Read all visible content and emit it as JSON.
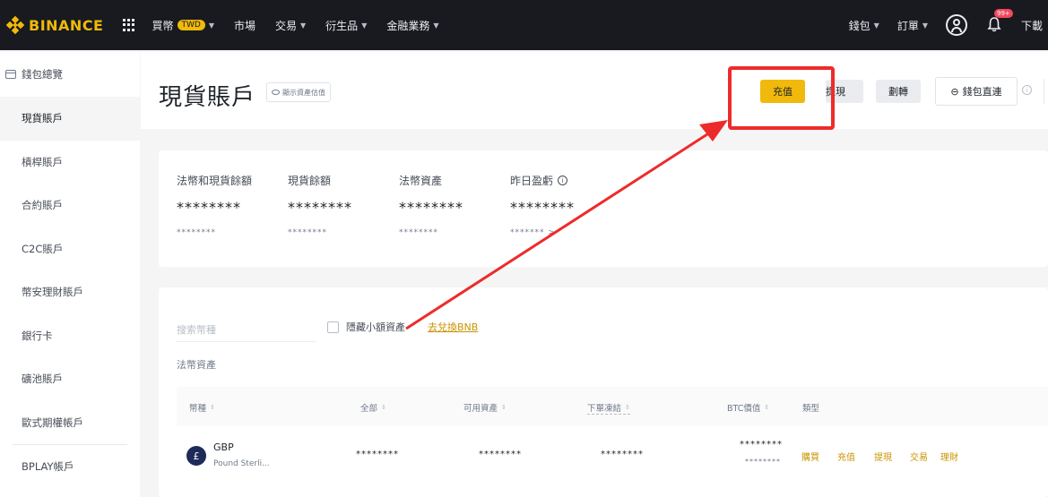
{
  "brand": {
    "name": "BINANCE"
  },
  "nav": {
    "buy_crypto": "買幣",
    "currency_badge": "TWD",
    "markets": "市場",
    "trade": "交易",
    "derivatives": "衍生品",
    "finance": "金融業務"
  },
  "top_right": {
    "wallet": "錢包",
    "orders": "訂單",
    "notification_count": "99+",
    "download": "下載"
  },
  "sidebar": {
    "items": [
      {
        "label": "錢包總覽"
      },
      {
        "label": "現貨賬戶"
      },
      {
        "label": "槓桿賬戶"
      },
      {
        "label": "合約賬戶"
      },
      {
        "label": "C2C賬戶"
      },
      {
        "label": "幣安理財賬戶"
      },
      {
        "label": "銀行卡"
      },
      {
        "label": "礦池賬戶"
      },
      {
        "label": "歐式期權帳戶"
      },
      {
        "label": "BPLAY帳戶"
      }
    ]
  },
  "header": {
    "title": "現貨賬戶",
    "show_balance": "顯示資產估值",
    "deposit": "充值",
    "withdraw": "提現",
    "transfer": "劃轉",
    "wallet_direct": "錢包直連"
  },
  "balances": [
    {
      "label": "法幣和現貨餘額",
      "value": "********",
      "sub": "********"
    },
    {
      "label": "現貨餘額",
      "value": "********",
      "sub": "********"
    },
    {
      "label": "法幣資產",
      "value": "********",
      "sub": "********"
    },
    {
      "label": "昨日盈虧",
      "value": "********",
      "sub": "******* >"
    }
  ],
  "assets": {
    "search_placeholder": "搜索幣種",
    "hide_small": "隱藏小額資產",
    "convert_bnb": "去兌換BNB",
    "fiat_section": "法幣資產",
    "columns": [
      "幣種",
      "全部",
      "可用資產",
      "下單凍結",
      "BTC價值",
      "類型"
    ],
    "rows": [
      {
        "symbol": "GBP",
        "name": "Pound Sterli...",
        "icon": "£",
        "total": "********",
        "available": "********",
        "frozen": "********",
        "btc_value": "********",
        "btc_sub": "********",
        "actions": [
          "購買",
          "充值",
          "提現",
          "交易",
          "理財"
        ]
      }
    ]
  },
  "colors": {
    "brand_yellow": "#f0b90b",
    "topbar_bg": "#181a20",
    "annotation_red": "#ee2b2b",
    "action_gold": "#c99400"
  }
}
